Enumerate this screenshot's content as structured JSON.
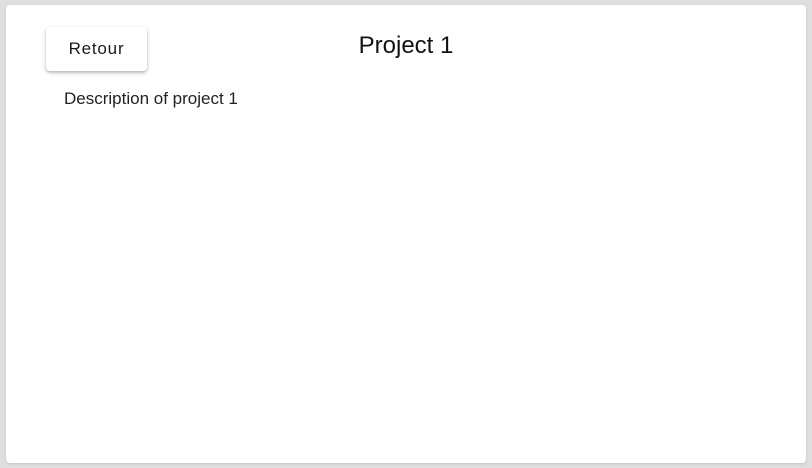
{
  "header": {
    "back_label": "Retour",
    "title": "Project 1"
  },
  "main": {
    "description": "Description of project 1"
  },
  "colors": {
    "page_background": "#dedede",
    "card_background": "#ffffff",
    "text": "#111111"
  }
}
